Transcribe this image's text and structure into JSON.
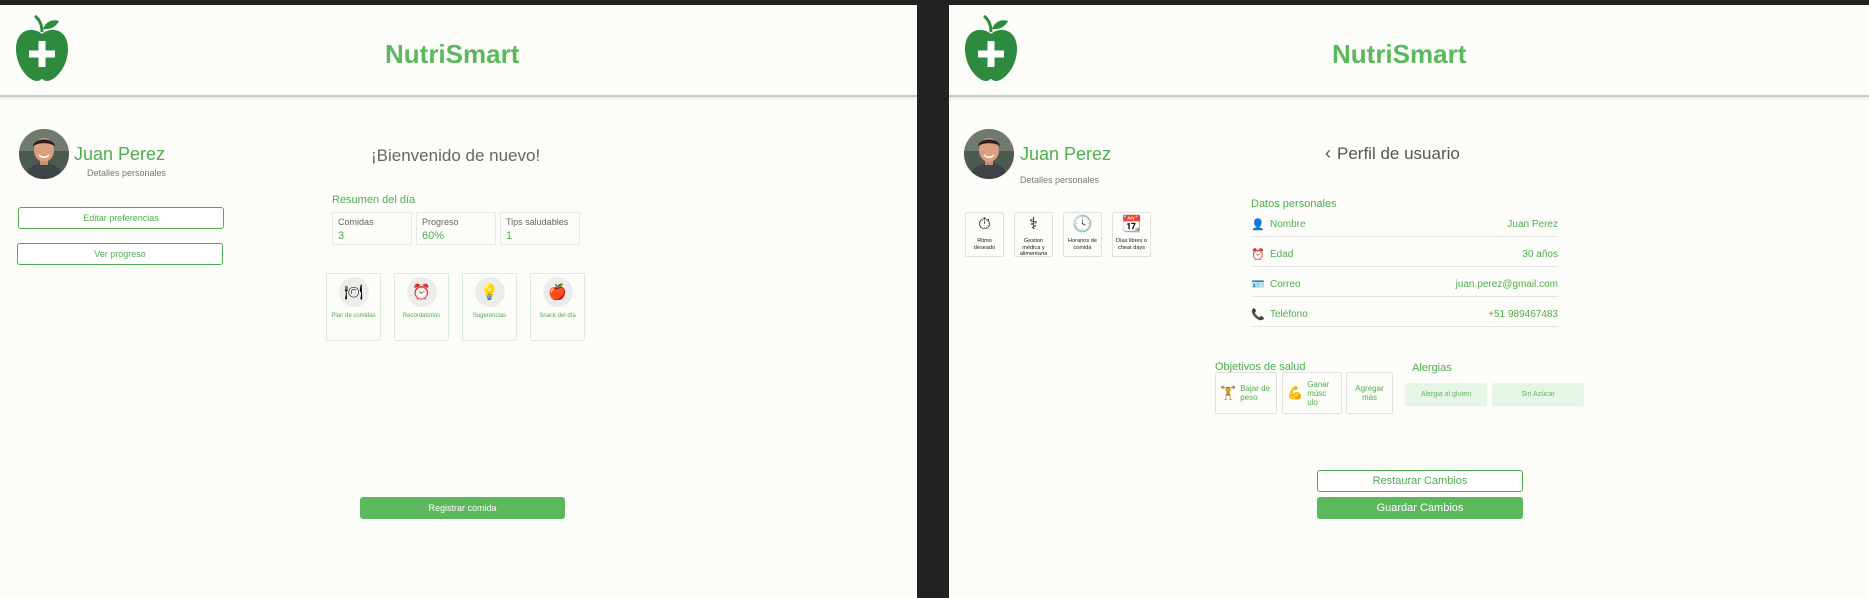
{
  "colors": {
    "brand": "#5cb85c",
    "background": "#fcfcf8",
    "divider": "#c8c8c4"
  },
  "app": {
    "title": "NutriSmart"
  },
  "user": {
    "name": "Juan Perez",
    "subtitle": "Detalles personales"
  },
  "dashboard": {
    "welcome": "¡Bienvenido de nuevo!",
    "edit_prefs_label": "Editar preferencias",
    "view_progress_label": "Ver progreso",
    "summary_title": "Resumen del día",
    "stats": [
      {
        "label": "Comidas",
        "value": "3"
      },
      {
        "label": "Progreso",
        "value": "60%"
      },
      {
        "label": "Tips saludables",
        "value": "1"
      }
    ],
    "features": [
      {
        "label": "Plan de comidas",
        "icon": "plate-icon"
      },
      {
        "label": "Recordatorios",
        "icon": "alarm-clock-icon"
      },
      {
        "label": "Sugerencias",
        "icon": "lightbulb-icon"
      },
      {
        "label": "Snack del día",
        "icon": "apple-icon"
      }
    ],
    "register_label": "Registrar comida"
  },
  "profile": {
    "title": "Perfil de usuario",
    "back_icon": "chevron-left-icon",
    "preferences": [
      {
        "label": "Ritmo deseado",
        "icon": "stopwatch-icon"
      },
      {
        "label": "Gestion médica y alimentaria",
        "icon": "medical-icon"
      },
      {
        "label": "Horarios de comida",
        "icon": "clock-icon"
      },
      {
        "label": "Días libres o cheat days",
        "icon": "calendar-icon"
      }
    ],
    "personal_title": "Datos personales",
    "personal": [
      {
        "icon": "user-icon",
        "label": "Nombre",
        "value": "Juan Perez"
      },
      {
        "icon": "alarm-icon",
        "label": "Edad",
        "value": "30 años"
      },
      {
        "icon": "id-card-icon",
        "label": "Correo",
        "value": "juan.perez@gmail.com"
      },
      {
        "icon": "phone-icon",
        "label": "Teléfono",
        "value": "+51 989467483"
      }
    ],
    "goals_title": "Objetivos de salud",
    "goals": [
      {
        "icon": "weightlifter-icon",
        "label": "Bajar de peso"
      },
      {
        "icon": "flexed-biceps-icon",
        "label": "Ganar músc ulo"
      },
      {
        "icon": "",
        "label": "Agregar más"
      }
    ],
    "allergies_title": "Alergias",
    "allergies": [
      "Alergia al gluten",
      "Sin Azúcar"
    ],
    "restore_label": "Restaurar Cambios",
    "save_label": "Guardar Cambios"
  }
}
